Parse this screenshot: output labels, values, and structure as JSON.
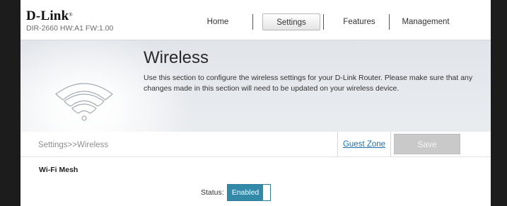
{
  "brand": {
    "logo_text": "D-Link",
    "model_info": "DIR-2660 HW:A1 FW:1.00"
  },
  "nav": {
    "home": "Home",
    "settings": "Settings",
    "features": "Features",
    "management": "Management"
  },
  "page": {
    "title": "Wireless",
    "description": "Use this section to configure the wireless settings for your D-Link Router. Please make sure that any changes made in this section will need to be updated on your wireless device.",
    "icon": "wifi-icon"
  },
  "breadcrumb": "Settings>>Wireless",
  "actions": {
    "guest_zone": "Guest Zone",
    "save": "Save"
  },
  "wifi_mesh": {
    "section_title": "Wi-Fi Mesh",
    "status_label": "Status:",
    "status_value": "Enabled"
  },
  "colors": {
    "toggle_accent": "#3389a8",
    "link": "#1a6fa8",
    "save_disabled": "#c9c9c9"
  }
}
